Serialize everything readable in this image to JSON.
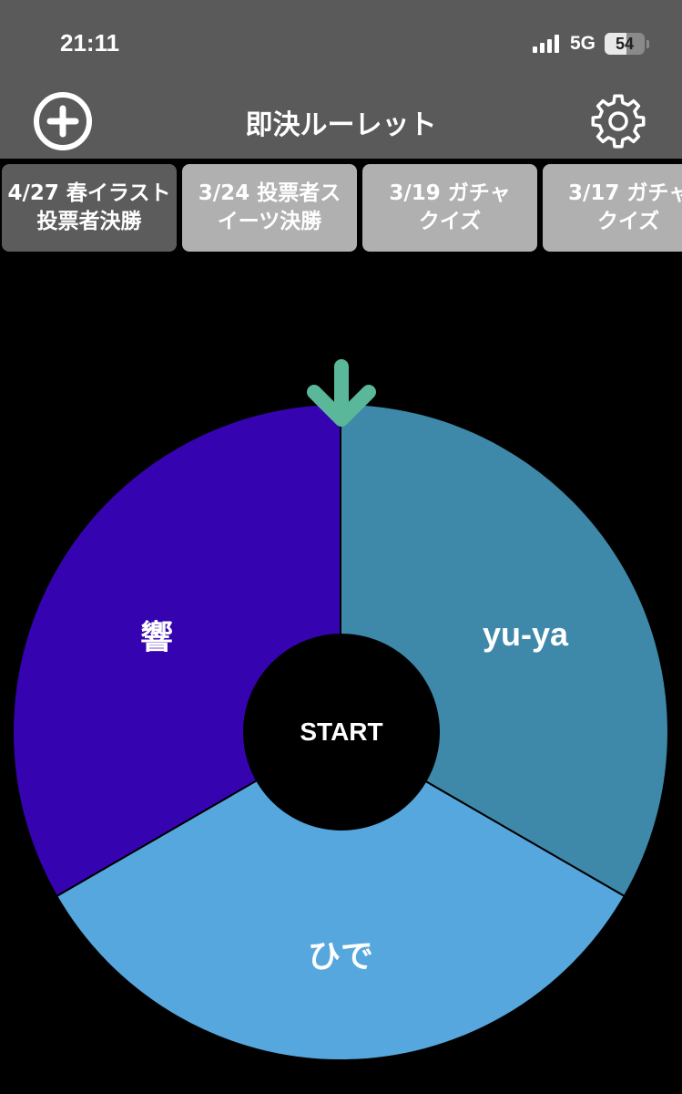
{
  "status_bar": {
    "time": "21:11",
    "network": "5G",
    "battery": "54",
    "battery_level_percent": 54
  },
  "header": {
    "title": "即決ルーレット",
    "add_icon": "plus-circle-icon",
    "settings_icon": "gear-icon"
  },
  "tabs": [
    {
      "line1": "4/27 春イラスト",
      "line2": "投票者決勝",
      "active": true
    },
    {
      "line1": "3/24 投票者ス",
      "line2": "イーツ決勝",
      "active": false
    },
    {
      "line1": "3/19 ガチャ",
      "line2": "クイズ",
      "active": false
    },
    {
      "line1": "3/17 ガチャ",
      "line2": "クイズ",
      "active": false
    }
  ],
  "roulette": {
    "pointer_icon": "arrow-down-icon",
    "pointer_color": "#5bb79a",
    "start_label": "START",
    "segments": [
      {
        "label": "yu-ya",
        "color": "#3e88a9"
      },
      {
        "label": "ひで",
        "color": "#56a7dd"
      },
      {
        "label": "響",
        "color": "#3603b0"
      }
    ]
  }
}
